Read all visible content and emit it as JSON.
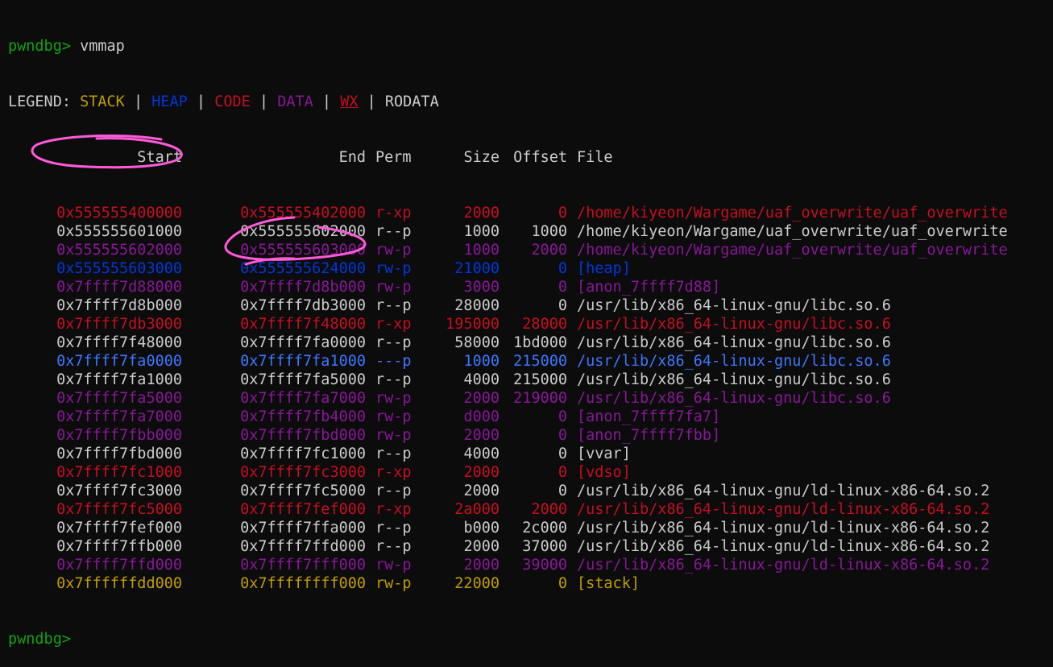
{
  "colors": {
    "prompt": "#13a10e",
    "default": "#cccccc",
    "stack": "#c19c00",
    "heap": "#0037da",
    "code": "#c50f1f",
    "data": "#881798",
    "wx": "#c50f1f",
    "rodata": "#cccccc",
    "guard": "#3b78ff",
    "annotation": "#ff5ad9"
  },
  "terminal": {
    "prompt": "pwndbg>",
    "command": " vmmap",
    "legend": {
      "label": "LEGEND:",
      "sep": " | ",
      "stack": "STACK",
      "heap": "HEAP",
      "code": "CODE",
      "data": "DATA",
      "wx": "WX",
      "rodata": "RODATA"
    },
    "headers": {
      "start": "Start",
      "end": "End",
      "perm": "Perm",
      "size": "Size",
      "offset": "Offset",
      "file": "File"
    },
    "rows": [
      {
        "start": "0x555555400000",
        "end": "0x555555402000",
        "perm": "r-xp",
        "size": "2000",
        "offset": "0",
        "file": "/home/kiyeon/Wargame/uaf_overwrite/uaf_overwrite",
        "color": "code"
      },
      {
        "start": "0x555555601000",
        "end": "0x555555602000",
        "perm": "r--p",
        "size": "1000",
        "offset": "1000",
        "file": "/home/kiyeon/Wargame/uaf_overwrite/uaf_overwrite",
        "color": "default"
      },
      {
        "start": "0x555555602000",
        "end": "0x555555603000",
        "perm": "rw-p",
        "size": "1000",
        "offset": "2000",
        "file": "/home/kiyeon/Wargame/uaf_overwrite/uaf_overwrite",
        "color": "data"
      },
      {
        "start": "0x555555603000",
        "end": "0x555555624000",
        "perm": "rw-p",
        "size": "21000",
        "offset": "0",
        "file": "[heap]",
        "color": "heap"
      },
      {
        "start": "0x7ffff7d88000",
        "end": "0x7ffff7d8b000",
        "perm": "rw-p",
        "size": "3000",
        "offset": "0",
        "file": "[anon_7ffff7d88]",
        "color": "data"
      },
      {
        "start": "0x7ffff7d8b000",
        "end": "0x7ffff7db3000",
        "perm": "r--p",
        "size": "28000",
        "offset": "0",
        "file": "/usr/lib/x86_64-linux-gnu/libc.so.6",
        "color": "default"
      },
      {
        "start": "0x7ffff7db3000",
        "end": "0x7ffff7f48000",
        "perm": "r-xp",
        "size": "195000",
        "offset": "28000",
        "file": "/usr/lib/x86_64-linux-gnu/libc.so.6",
        "color": "code"
      },
      {
        "start": "0x7ffff7f48000",
        "end": "0x7ffff7fa0000",
        "perm": "r--p",
        "size": "58000",
        "offset": "1bd000",
        "file": "/usr/lib/x86_64-linux-gnu/libc.so.6",
        "color": "default"
      },
      {
        "start": "0x7ffff7fa0000",
        "end": "0x7ffff7fa1000",
        "perm": "---p",
        "size": "1000",
        "offset": "215000",
        "file": "/usr/lib/x86_64-linux-gnu/libc.so.6",
        "color": "guard"
      },
      {
        "start": "0x7ffff7fa1000",
        "end": "0x7ffff7fa5000",
        "perm": "r--p",
        "size": "4000",
        "offset": "215000",
        "file": "/usr/lib/x86_64-linux-gnu/libc.so.6",
        "color": "default"
      },
      {
        "start": "0x7ffff7fa5000",
        "end": "0x7ffff7fa7000",
        "perm": "rw-p",
        "size": "2000",
        "offset": "219000",
        "file": "/usr/lib/x86_64-linux-gnu/libc.so.6",
        "color": "data"
      },
      {
        "start": "0x7ffff7fa7000",
        "end": "0x7ffff7fb4000",
        "perm": "rw-p",
        "size": "d000",
        "offset": "0",
        "file": "[anon_7ffff7fa7]",
        "color": "data"
      },
      {
        "start": "0x7ffff7fbb000",
        "end": "0x7ffff7fbd000",
        "perm": "rw-p",
        "size": "2000",
        "offset": "0",
        "file": "[anon_7ffff7fbb]",
        "color": "data"
      },
      {
        "start": "0x7ffff7fbd000",
        "end": "0x7ffff7fc1000",
        "perm": "r--p",
        "size": "4000",
        "offset": "0",
        "file": "[vvar]",
        "color": "default"
      },
      {
        "start": "0x7ffff7fc1000",
        "end": "0x7ffff7fc3000",
        "perm": "r-xp",
        "size": "2000",
        "offset": "0",
        "file": "[vdso]",
        "color": "code"
      },
      {
        "start": "0x7ffff7fc3000",
        "end": "0x7ffff7fc5000",
        "perm": "r--p",
        "size": "2000",
        "offset": "0",
        "file": "/usr/lib/x86_64-linux-gnu/ld-linux-x86-64.so.2",
        "color": "default"
      },
      {
        "start": "0x7ffff7fc5000",
        "end": "0x7ffff7fef000",
        "perm": "r-xp",
        "size": "2a000",
        "offset": "2000",
        "file": "/usr/lib/x86_64-linux-gnu/ld-linux-x86-64.so.2",
        "color": "code"
      },
      {
        "start": "0x7ffff7fef000",
        "end": "0x7ffff7ffa000",
        "perm": "r--p",
        "size": "b000",
        "offset": "2c000",
        "file": "/usr/lib/x86_64-linux-gnu/ld-linux-x86-64.so.2",
        "color": "default"
      },
      {
        "start": "0x7ffff7ffb000",
        "end": "0x7ffff7ffd000",
        "perm": "r--p",
        "size": "2000",
        "offset": "37000",
        "file": "/usr/lib/x86_64-linux-gnu/ld-linux-x86-64.so.2",
        "color": "default"
      },
      {
        "start": "0x7ffff7ffd000",
        "end": "0x7ffff7fff000",
        "perm": "rw-p",
        "size": "2000",
        "offset": "39000",
        "file": "/usr/lib/x86_64-linux-gnu/ld-linux-x86-64.so.2",
        "color": "data"
      },
      {
        "start": "0x7ffffffdd000",
        "end": "0x7ffffffff000",
        "perm": "rw-p",
        "size": "22000",
        "offset": "0",
        "file": "[stack]",
        "color": "stack"
      }
    ],
    "next_prompt": "pwndbg>"
  }
}
